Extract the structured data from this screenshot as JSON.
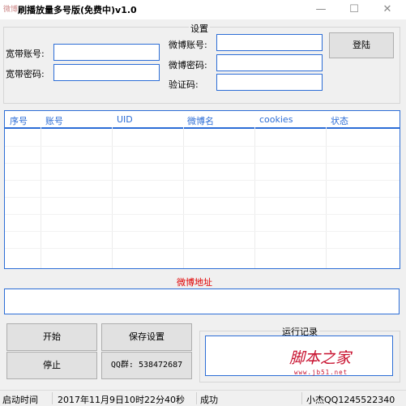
{
  "window": {
    "title": "刷播放量多号版(免费中)v1.0",
    "icon_text": "微博"
  },
  "settings": {
    "legend": "设置",
    "broadband_account_label": "宽带账号:",
    "broadband_password_label": "宽带密码:",
    "weibo_account_label": "微博账号:",
    "weibo_password_label": "微博密码:",
    "captcha_label": "验证码:",
    "login_button": "登陆"
  },
  "table": {
    "columns": [
      "序号",
      "账号",
      "UID",
      "微博名",
      "cookies",
      "状态"
    ],
    "rows": []
  },
  "weibo_url": {
    "label": "微博地址",
    "value": ""
  },
  "controls": {
    "start": "开始",
    "stop": "停止",
    "save_settings": "保存设置",
    "qq_group": "QQ群: 538472687"
  },
  "log": {
    "legend": "运行记录",
    "content": ""
  },
  "statusbar": {
    "start_time_label": "启动时间",
    "start_time_value": "2017年11月9日10时22分40秒",
    "status": "成功",
    "author": "小杰QQ1245522340"
  },
  "watermark": {
    "text": "脚本之家",
    "url": "www.jb51.net"
  },
  "colors": {
    "accent_blue": "#2c6dd6",
    "red": "#e00000",
    "watermark": "#c8102e"
  }
}
